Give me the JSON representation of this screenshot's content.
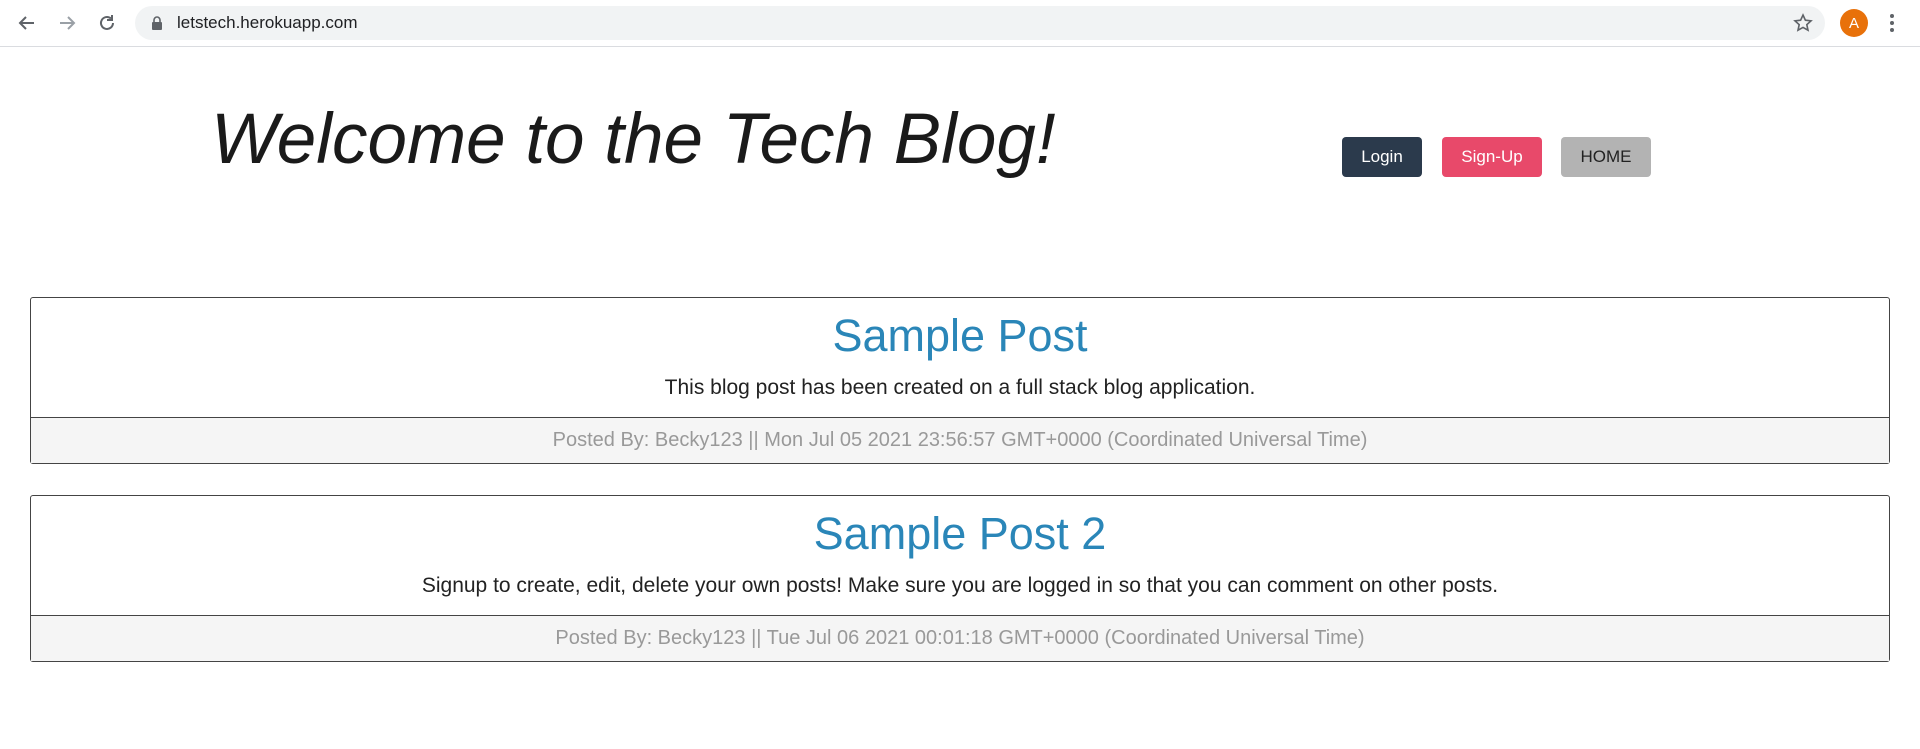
{
  "browser": {
    "url": "letstech.herokuapp.com",
    "avatar_letter": "A"
  },
  "header": {
    "title": "Welcome to the Tech Blog!",
    "buttons": {
      "login": "Login",
      "signup": "Sign-Up",
      "home": "HOME"
    }
  },
  "posts": [
    {
      "title": "Sample Post",
      "content": "This blog post has been created on a full stack blog application.",
      "footer": "Posted By: Becky123 || Mon Jul 05 2021 23:56:57 GMT+0000 (Coordinated Universal Time)"
    },
    {
      "title": "Sample Post 2",
      "content": "Signup to create, edit, delete your own posts! Make sure you are logged in so that you can comment on other posts.",
      "footer": "Posted By: Becky123 || Tue Jul 06 2021 00:01:18 GMT+0000 (Coordinated Universal Time)"
    }
  ],
  "colors": {
    "login_button": "#2b3a4c",
    "signup_button": "#e8496a",
    "home_button": "#b3b3b3",
    "post_title": "#2a86b8",
    "avatar": "#e8710a"
  }
}
